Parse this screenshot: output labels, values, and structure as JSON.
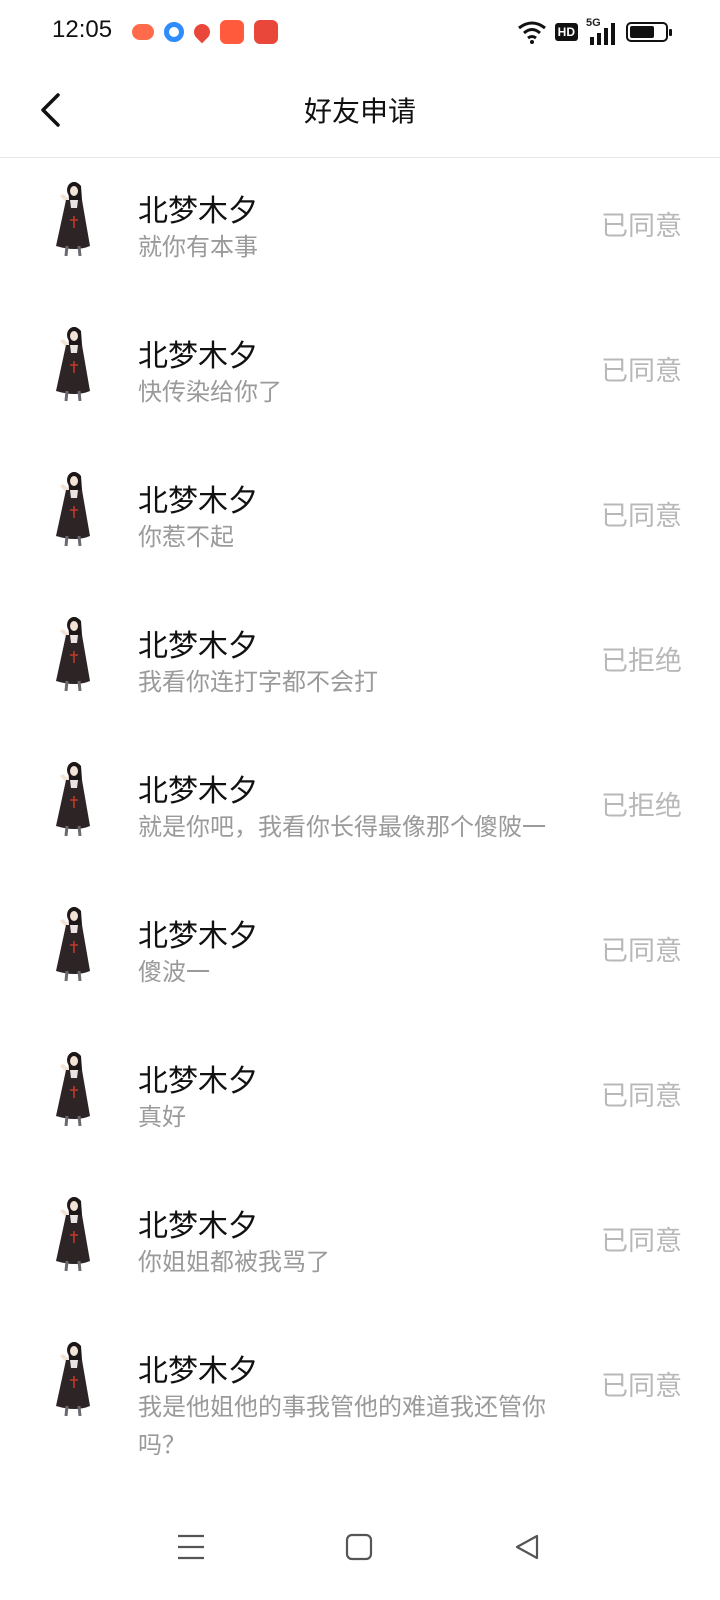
{
  "status_bar": {
    "time": "12:05",
    "app_icons": [
      "game-app-icon",
      "browser-app-icon",
      "map-pin-app-icon",
      "video-app-icon",
      "listen-app-icon"
    ],
    "hd_label": "HD",
    "network": "5G",
    "battery_level": 0.7
  },
  "header": {
    "title": "好友申请"
  },
  "requests": [
    {
      "name": "北梦木夕",
      "message": "就你有本事",
      "status": "已同意"
    },
    {
      "name": "北梦木夕",
      "message": "快传染给你了",
      "status": "已同意"
    },
    {
      "name": "北梦木夕",
      "message": "你惹不起",
      "status": "已同意"
    },
    {
      "name": "北梦木夕",
      "message": "我看你连打字都不会打",
      "status": "已拒绝"
    },
    {
      "name": "北梦木夕",
      "message": "就是你吧，我看你长得最像那个傻陂一",
      "status": "已拒绝"
    },
    {
      "name": "北梦木夕",
      "message": "傻波一",
      "status": "已同意"
    },
    {
      "name": "北梦木夕",
      "message": "真好",
      "status": "已同意"
    },
    {
      "name": "北梦木夕",
      "message": "你姐姐都被我骂了",
      "status": "已同意"
    },
    {
      "name": "北梦木夕",
      "message": "我是他姐他的事我管他的难道我还管你吗？",
      "status": "已同意"
    }
  ],
  "colors": {
    "accent_red": "#e8473a",
    "muted_text": "#9a9a9a",
    "status_text": "#b8b8b8"
  }
}
